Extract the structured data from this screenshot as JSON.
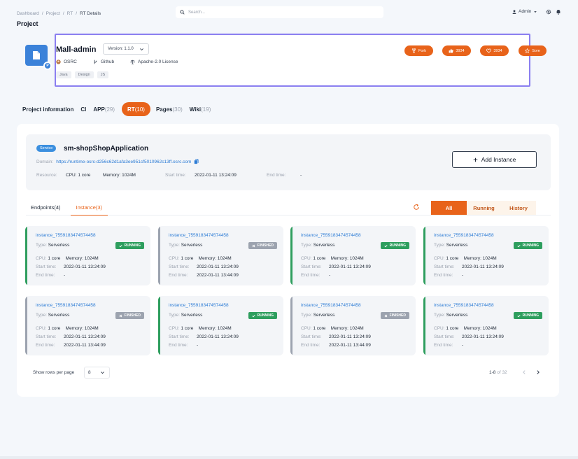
{
  "breadcrumb": [
    "Dashboard",
    "/",
    "Project",
    "/",
    "RT",
    "/",
    "RT Details"
  ],
  "page_title": "Project",
  "search": {
    "placeholder": "Search..."
  },
  "user": {
    "name": "Admin"
  },
  "project": {
    "name": "Mall-admin",
    "version": "Version: 1.1.0",
    "owner": "OSRC",
    "repo": "Github",
    "license": "Apache-2.0 License",
    "tags": [
      "Java",
      "Design",
      "JS"
    ],
    "badge_letter": "P",
    "actions": [
      {
        "label": "Fork",
        "icon": "fork-icon"
      },
      {
        "label": "3934",
        "icon": "thumbs-up-icon"
      },
      {
        "label": "3934",
        "icon": "heart-icon"
      },
      {
        "label": "Sore",
        "icon": "star-icon"
      }
    ]
  },
  "tabs": [
    {
      "label": "Project information",
      "count": ""
    },
    {
      "label": "CI",
      "count": ""
    },
    {
      "label": "APP",
      "count": "(29)"
    },
    {
      "label": "RT",
      "count": "(10)",
      "active": true
    },
    {
      "label": "Pages",
      "count": "(30)"
    },
    {
      "label": "Wiki",
      "count": "(19)"
    }
  ],
  "service": {
    "badge": "Service",
    "name": "sm-shopShopApplication",
    "domain_label": "Domain:",
    "domain": "https://runtime-osrc-d256c62d1afa3ee951cf5010962c13ff.osrc.com",
    "resource_label": "Resource:",
    "cpu": "CPU: 1 core",
    "memory": "Memory: 1024M",
    "start_label": "Start time:",
    "start": "2022-01-11 13:24:09",
    "end_label": "End time:",
    "end": "-",
    "add_button": "Add Instance"
  },
  "subtabs": [
    "Endpoints(4)",
    "Instance(3)"
  ],
  "filters": [
    "All",
    "Running",
    "History"
  ],
  "instance_labels": {
    "type": "Type:",
    "cpu": "CPU:",
    "memory": "Memory:",
    "start": "Start time:",
    "end": "End time:"
  },
  "instances": [
    {
      "name": "instance_7559183474574458",
      "type": "Serverless",
      "status": "RUNNING",
      "cpu": "1 core",
      "memory": "1024M",
      "start": "2022-01-11 13:24:09",
      "end": "-"
    },
    {
      "name": "instance_7559183474574458",
      "type": "Serverless",
      "status": "FINISHED",
      "cpu": "1 core",
      "memory": "1024M",
      "start": "2022-01-11 13:24:09",
      "end": "2022-01-11 13:44:09"
    },
    {
      "name": "instance_7559183474574458",
      "type": "Serverless",
      "status": "RUNNING",
      "cpu": "1 core",
      "memory": "1024M",
      "start": "2022-01-11 13:24:09",
      "end": "-"
    },
    {
      "name": "instance_7559183474574458",
      "type": "Serverless",
      "status": "RUNNING",
      "cpu": "1 core",
      "memory": "1024M",
      "start": "2022-01-11 13:24:09",
      "end": "-"
    },
    {
      "name": "instance_7559183474574458",
      "type": "Serverless",
      "status": "FINISHED",
      "cpu": "1 core",
      "memory": "1024M",
      "start": "2022-01-11 13:24:09",
      "end": "2022-01-11 13:44:09"
    },
    {
      "name": "instance_7559183474574458",
      "type": "Serverless",
      "status": "RUNNING",
      "cpu": "1 core",
      "memory": "1024M",
      "start": "2022-01-11 13:24:09",
      "end": "-"
    },
    {
      "name": "instance_7559183474574458",
      "type": "Serverless",
      "status": "FINISHED",
      "cpu": "1 core",
      "memory": "1024M",
      "start": "2022-01-11 13:24:09",
      "end": "2022-01-11 13:44:09"
    },
    {
      "name": "instance_7559183474574458",
      "type": "Serverless",
      "status": "RUNNING",
      "cpu": "1 core",
      "memory": "1024M",
      "start": "2022-01-11 13:24:09",
      "end": "-"
    }
  ],
  "pager": {
    "rows_label": "Show rows per page",
    "rows_value": "8",
    "range": "1-8",
    "of": "of 32"
  },
  "colors": {
    "accent": "#e8631a",
    "running": "#2e9e5e",
    "finished": "#9ca3af",
    "link": "#2b7bd5",
    "focus": "#8b7ff0"
  }
}
